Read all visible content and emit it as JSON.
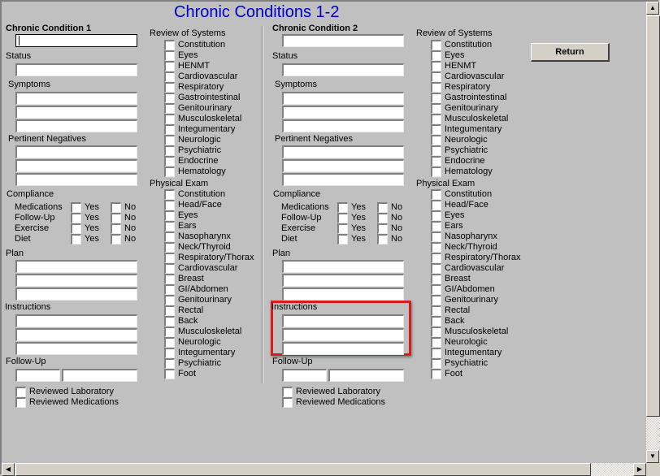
{
  "title": "Chronic Conditions 1-2",
  "return_button": "Return",
  "ros_items": [
    "Constitution",
    "Eyes",
    "HENMT",
    "Cardiovascular",
    "Respiratory",
    "Gastrointestinal",
    "Genitourinary",
    "Musculoskeletal",
    "Integumentary",
    "Neurologic",
    "Psychiatric",
    "Endocrine",
    "Hematology"
  ],
  "pe_items": [
    "Constitution",
    "Head/Face",
    "Eyes",
    "Ears",
    "Nasopharynx",
    "Neck/Thyroid",
    "Respiratory/Thorax",
    "Cardiovascular",
    "Breast",
    "GI/Abdomen",
    "Genitourinary",
    "Rectal",
    "Back",
    "Musculoskeletal",
    "Neurologic",
    "Integumentary",
    "Psychiatric",
    "Foot"
  ],
  "labels": {
    "status": "Status",
    "symptoms": "Symptoms",
    "pertinent_negatives": "Pertinent Negatives",
    "compliance": "Compliance",
    "plan": "Plan",
    "instructions": "Instructions",
    "follow_up": "Follow-Up",
    "review_of_systems": "Review of Systems",
    "physical_exam": "Physical Exam",
    "yes": "Yes",
    "no": "No",
    "reviewed_laboratory": "Reviewed Laboratory",
    "reviewed_medications": "Reviewed Medications"
  },
  "compliance_items": [
    "Medications",
    "Follow-Up",
    "Exercise",
    "Diet"
  ],
  "conditions": [
    {
      "heading": "Chronic Condition 1",
      "condition_value": "",
      "status_value": "",
      "symptoms": [
        "",
        "",
        ""
      ],
      "pertinent_negatives": [
        "",
        "",
        ""
      ],
      "plan": [
        "",
        "",
        ""
      ],
      "instructions": [
        "",
        "",
        ""
      ],
      "follow_up": [
        "",
        ""
      ]
    },
    {
      "heading": "Chronic Condition 2",
      "condition_value": "",
      "status_value": "",
      "symptoms": [
        "",
        "",
        ""
      ],
      "pertinent_negatives": [
        "",
        "",
        ""
      ],
      "plan": [
        "",
        "",
        ""
      ],
      "instructions": [
        "",
        "",
        ""
      ],
      "follow_up": [
        "",
        ""
      ]
    }
  ],
  "highlight_color": "#d81b1b",
  "title_color": "#0000cc"
}
